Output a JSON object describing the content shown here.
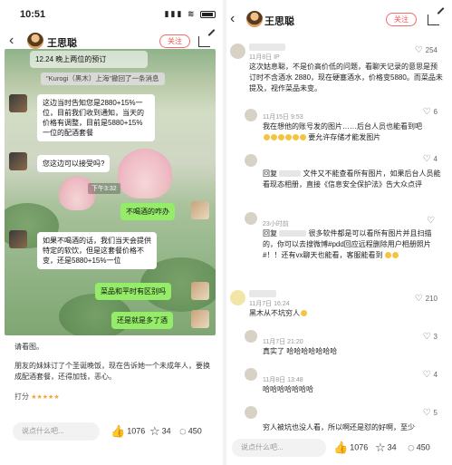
{
  "left": {
    "status_time": "10:51",
    "header": {
      "username": "王思聪",
      "follow_label": "关注"
    },
    "chat": {
      "top_text": "12.24 晚上两位的预订",
      "recall_notice": "\"Kurogi（黑木）上海\"撤回了一条消息",
      "msg1": "这边当时告知您是2880+15%一位，目前我们收到通知，当天的价格有调整，目前是5880+15%一位的配酒套餐",
      "msg2": "您这边可以接受吗?",
      "time_label": "下午3:32",
      "msg3": "不喝酒的咋办",
      "msg4": "如果不喝酒的话，我们当天会提供特定的软饮，但是这套餐价格不变，还是5880+15%一位",
      "msg5": "菜品和平时有区别吗",
      "msg6": "还是就是多了酒"
    },
    "post": {
      "line1": "请看图。",
      "line2": "朋友的妹妹订了个圣诞晚饭，现在告诉她一个未成年人，要换成配酒套餐，还得加钱，恶心。",
      "rating_label": "打分",
      "rating_stars": "★★★★★"
    },
    "bottom": {
      "placeholder": "说点什么吧...",
      "likes": "1076",
      "stars": "34",
      "comments": "450"
    }
  },
  "right": {
    "header": {
      "username": "王思聪",
      "follow_label": "关注"
    },
    "comments": [
      {
        "meta": "11月8日 IP",
        "likes": "254",
        "text": "这次姑息聪，不是价高价低的问题，看聊天记录的意思是预订时不含酒水 2880，现在硬塞酒水，价格变5880。而菜品未提及，视作菜品未变。"
      },
      {
        "meta": "11月15日 9:53",
        "likes": "6",
        "text": "我在想他的账号发的图片……后台人员也能看到吧",
        "text2": "要允许存储才能发图片"
      },
      {
        "meta": "",
        "likes": "4",
        "text": "回复",
        "text2": "文件又不能查看所有图片，如果后台人员能看现态相册，直接《信息安全保护法》告大众点评"
      },
      {
        "meta": "23小时前",
        "likes": "",
        "text": "回复",
        "text2": "很多软件都是可以看所有图片并且扫描的，你可以去搜微博#pdd回应远程删除用户相册照片#！！还有vx聊天也能看，客服能看到"
      },
      {
        "meta": "11月7日 16:24",
        "likes": "210",
        "text": "黑木从不坑穷人"
      },
      {
        "meta": "11月7日 21:20",
        "likes": "3",
        "text": "真实了 哈哈哈哈哈哈哈"
      },
      {
        "meta": "11月8日 13:48",
        "likes": "4",
        "text": "哈哈哈哈哈哈哈"
      },
      {
        "meta": "",
        "likes": "5",
        "text": "穷人被坑也没人看，所以啊还是怼的好啊，至少"
      }
    ],
    "bottom": {
      "placeholder": "说点什么吧...",
      "likes": "1076",
      "stars": "34",
      "comments": "450"
    }
  }
}
